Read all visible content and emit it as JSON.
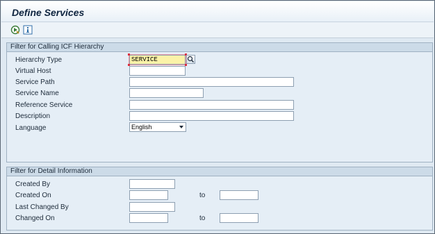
{
  "window": {
    "title": "Define Services"
  },
  "toolbar": {
    "execute_icon": "execute-icon",
    "info_icon": "information-icon"
  },
  "filter_icf": {
    "heading": "Filter for Calling ICF Hierarchy",
    "hierarchy_type": {
      "label": "Hierarchy Type",
      "value": "SERVICE"
    },
    "virtual_host": {
      "label": "Virtual Host",
      "value": ""
    },
    "service_path": {
      "label": "Service Path",
      "value": ""
    },
    "service_name": {
      "label": "Service Name",
      "value": ""
    },
    "reference_service": {
      "label": "Reference Service",
      "value": ""
    },
    "description": {
      "label": "Description",
      "value": ""
    },
    "language": {
      "label": "Language",
      "value": "English"
    }
  },
  "filter_detail": {
    "heading": "Filter for Detail Information",
    "created_by": {
      "label": "Created By",
      "value": ""
    },
    "created_on": {
      "label": "Created On",
      "from": "",
      "to_label": "to",
      "to": ""
    },
    "last_changed_by": {
      "label": "Last Changed By",
      "value": ""
    },
    "changed_on": {
      "label": "Changed On",
      "from": "",
      "to_label": "to",
      "to": ""
    }
  },
  "colors": {
    "required_field": "#fbf2a8",
    "background": "#dfe9f2",
    "group_header": "#ccdbe8"
  }
}
